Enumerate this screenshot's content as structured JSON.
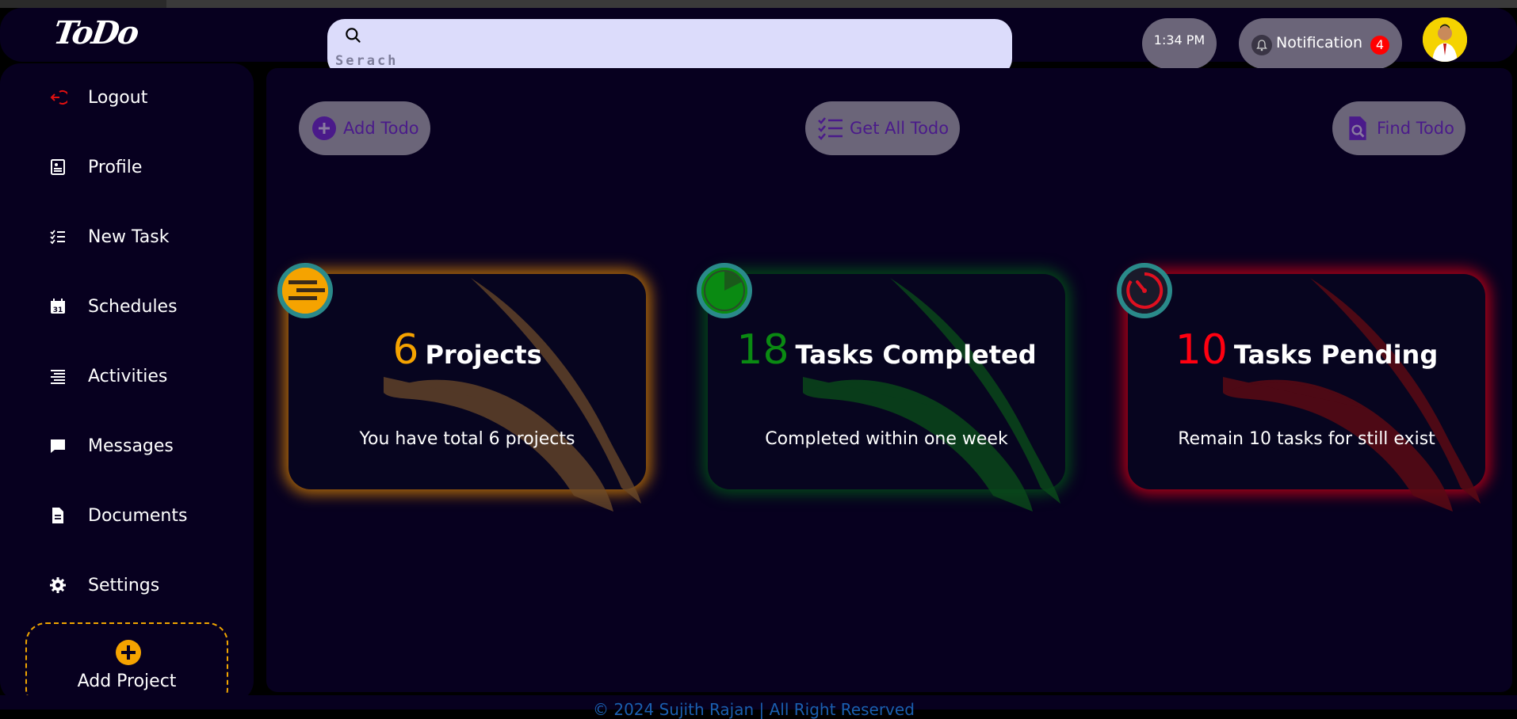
{
  "app": {
    "logo": "ToDo"
  },
  "header": {
    "search_placeholder": "Serach",
    "time": "1:34 PM",
    "notification_label": "Notification",
    "notification_count": "4"
  },
  "sidebar": {
    "items": [
      {
        "label": "Logout",
        "icon": "logout-icon"
      },
      {
        "label": "Profile",
        "icon": "profile-icon"
      },
      {
        "label": "New Task",
        "icon": "task-list-icon"
      },
      {
        "label": "Schedules",
        "icon": "calendar-icon"
      },
      {
        "label": "Activities",
        "icon": "activities-icon"
      },
      {
        "label": "Messages",
        "icon": "message-icon"
      },
      {
        "label": "Documents",
        "icon": "document-icon"
      },
      {
        "label": "Settings",
        "icon": "gear-icon"
      }
    ],
    "add_project_label": "Add Project"
  },
  "toolbar": {
    "add_todo": "Add Todo",
    "get_all_todo": "Get All Todo",
    "find_todo": "Find Todo"
  },
  "cards": [
    {
      "number": "6",
      "title": "Projects",
      "subtitle": "You have total 6 projects",
      "accent": "#f5a300"
    },
    {
      "number": "18",
      "title": "Tasks Completed",
      "subtitle": "Completed within one week",
      "accent": "#0a8a12"
    },
    {
      "number": "10",
      "title": "Tasks Pending",
      "subtitle": "Remain 10 tasks for still exist",
      "accent": "#ff0010"
    }
  ],
  "footer": {
    "text": "© 2024 Sujith Rajan | All Right Reserved"
  },
  "colors": {
    "background": "#07001f",
    "search_bg": "#dcdcfb",
    "pill_bg": "#6b6579",
    "logout_red": "#e01010"
  }
}
